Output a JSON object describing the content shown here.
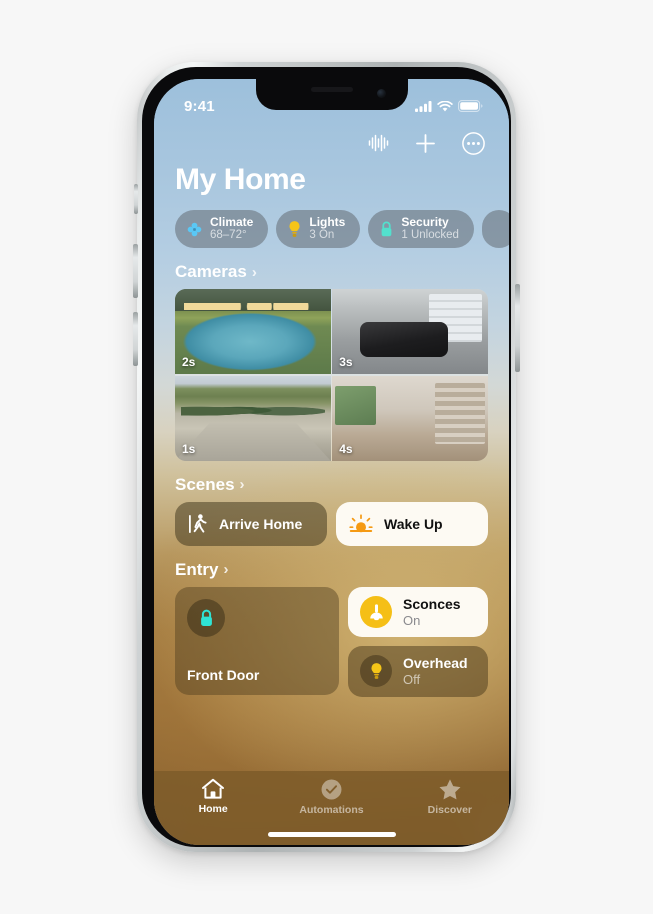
{
  "status_bar": {
    "time": "9:41",
    "icons": [
      "cellular-signal-icon",
      "wifi-icon",
      "battery-icon"
    ]
  },
  "header": {
    "title": "My Home",
    "actions": [
      {
        "name": "audio-waveform-icon"
      },
      {
        "name": "add-icon"
      },
      {
        "name": "more-options-icon"
      }
    ]
  },
  "status_chips": [
    {
      "icon": "fan-icon",
      "title": "Climate",
      "subtitle": "68–72°",
      "color": "#5ac8f5"
    },
    {
      "icon": "bulb-icon",
      "title": "Lights",
      "subtitle": "3 On",
      "color": "#f5c518"
    },
    {
      "icon": "lock-icon",
      "title": "Security",
      "subtitle": "1 Unlocked",
      "color": "#53e0cd"
    }
  ],
  "sections": {
    "cameras": {
      "label": "Cameras",
      "chevron": "›",
      "tiles": [
        {
          "name": "camera-pool",
          "timestamp": "2s"
        },
        {
          "name": "camera-garage",
          "timestamp": "3s"
        },
        {
          "name": "camera-street",
          "timestamp": "1s"
        },
        {
          "name": "camera-living",
          "timestamp": "4s"
        }
      ]
    },
    "scenes": {
      "label": "Scenes",
      "chevron": "›",
      "items": [
        {
          "name": "arrive-home",
          "label": "Arrive Home",
          "icon": "walking-person-icon",
          "active": false
        },
        {
          "name": "wake-up",
          "label": "Wake Up",
          "icon": "sunrise-icon",
          "active": true
        }
      ]
    },
    "entry": {
      "label": "Entry",
      "chevron": "›",
      "lock_tile": {
        "label": "Front Door",
        "icon": "lock-icon",
        "color": "#2fe3d4"
      },
      "accessories": [
        {
          "name": "sconces",
          "label": "Sconces",
          "state": "On",
          "icon": "sconce-lamp-icon",
          "active": true
        },
        {
          "name": "overhead",
          "label": "Overhead",
          "state": "Off",
          "icon": "bulb-icon",
          "active": false
        }
      ]
    }
  },
  "tab_bar": {
    "tabs": [
      {
        "name": "home",
        "label": "Home",
        "icon": "house-icon",
        "selected": true
      },
      {
        "name": "automations",
        "label": "Automations",
        "icon": "clock-check-icon",
        "selected": false
      },
      {
        "name": "discover",
        "label": "Discover",
        "icon": "star-icon",
        "selected": false
      }
    ]
  }
}
